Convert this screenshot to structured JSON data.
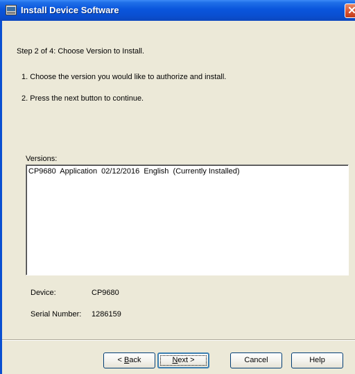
{
  "window": {
    "title": "Install Device Software"
  },
  "step_text": "Step 2 of 4:  Choose Version to Install.",
  "instructions": [
    "1.  Choose the version you would like to authorize and install.",
    "2.  Press the next button to continue."
  ],
  "versions": {
    "label": "Versions:",
    "items": [
      "CP9680  Application  02/12/2016  English  (Currently Installed)"
    ]
  },
  "device": {
    "label": "Device:",
    "value": "CP9680"
  },
  "serial": {
    "label": "Serial Number:",
    "value": "1286159"
  },
  "buttons": {
    "back": {
      "prefix": "< ",
      "accel": "B",
      "rest": "ack"
    },
    "next": {
      "accel": "N",
      "rest": "ext >"
    },
    "cancel": "Cancel",
    "help": "Help"
  },
  "icons": {
    "title": "installer-window-icon",
    "close": "close-icon"
  },
  "colors": {
    "titlebar": "#0a4fd1",
    "close": "#d7512f",
    "face": "#ece9d8"
  }
}
